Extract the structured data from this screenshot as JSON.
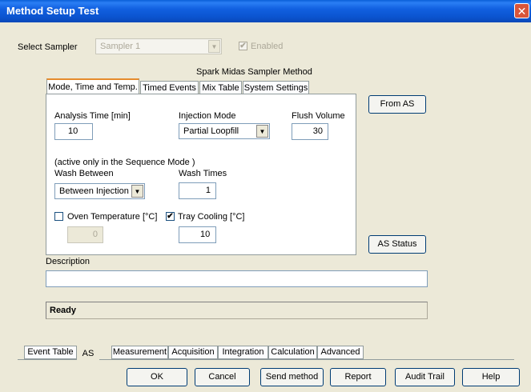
{
  "window": {
    "title": "Method Setup Test",
    "close_glyph": "✕"
  },
  "sampler": {
    "label": "Select Sampler",
    "value": "Sampler 1",
    "enabled_label": "Enabled"
  },
  "method_title": "Spark Midas Sampler Method",
  "tabs": [
    {
      "label": "Mode, Time and Temp.",
      "active": true
    },
    {
      "label": "Timed Events"
    },
    {
      "label": "Mix Table"
    },
    {
      "label": "System Settings"
    }
  ],
  "form": {
    "analysis_time_label": "Analysis Time [min]",
    "analysis_time_value": "10",
    "injection_mode_label": "Injection Mode",
    "injection_mode_value": "Partial Loopfill",
    "flush_volume_label": "Flush Volume",
    "flush_volume_value": "30",
    "sequence_note": "(active only in the Sequence Mode )",
    "wash_between_label": "Wash Between",
    "wash_between_value": "Between Injection",
    "wash_times_label": "Wash Times",
    "wash_times_value": "1",
    "oven_temp_label": "Oven Temperature [°C]",
    "oven_temp_value": "0",
    "tray_cooling_label": "Tray Cooling [°C]",
    "tray_cooling_value": "10"
  },
  "buttons": {
    "from_as": "From AS",
    "as_status": "AS Status"
  },
  "description_label": "Description",
  "description_value": "",
  "status_text": "Ready",
  "bottom_tabs": [
    {
      "label": "Event Table"
    },
    {
      "label": "AS",
      "active": true
    },
    {
      "label": "Measurement"
    },
    {
      "label": "Acquisition"
    },
    {
      "label": "Integration"
    },
    {
      "label": "Calculation"
    },
    {
      "label": "Advanced"
    }
  ],
  "footer_buttons": {
    "ok": "OK",
    "cancel": "Cancel",
    "send_method": "Send method",
    "report": "Report",
    "audit_trail": "Audit Trail",
    "help": "Help"
  },
  "glyphs": {
    "check": "✔",
    "dropdown": "▼"
  }
}
